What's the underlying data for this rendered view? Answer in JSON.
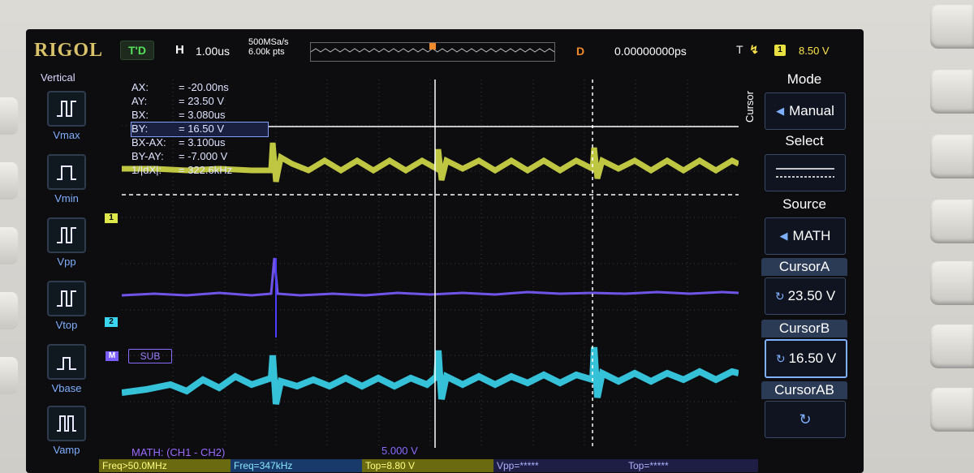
{
  "header": {
    "brand": "RIGOL",
    "trigger_status": "T'D",
    "horizontal_label": "H",
    "timebase": "1.00us",
    "sample_rate": "500MSa/s",
    "memory_depth": "6.00k pts",
    "delay_label": "D",
    "delay_value": "0.00000000ps",
    "trigger_label": "T",
    "trigger_channel": "1",
    "trigger_level": "8.50 V"
  },
  "vertical_menu": {
    "title": "Vertical",
    "items": [
      {
        "label": "Vmax",
        "icon": "vmax-icon"
      },
      {
        "label": "Vmin",
        "icon": "vmin-icon"
      },
      {
        "label": "Vpp",
        "icon": "vpp-icon"
      },
      {
        "label": "Vtop",
        "icon": "vtop-icon"
      },
      {
        "label": "Vbase",
        "icon": "vbase-icon"
      },
      {
        "label": "Vamp",
        "icon": "vamp-icon"
      }
    ]
  },
  "cursor_readout": [
    {
      "key": "AX:",
      "value": "= -20.00ns"
    },
    {
      "key": "AY:",
      "value": "= 23.50 V"
    },
    {
      "key": "BX:",
      "value": "= 3.080us"
    },
    {
      "key": "BY:",
      "value": "= 16.50 V"
    },
    {
      "key": "BX-AX:",
      "value": "= 3.100us"
    },
    {
      "key": "BY-AY:",
      "value": "= -7.000 V"
    },
    {
      "key": "1/|dX|:",
      "value": "= 322.6kHz"
    }
  ],
  "cursor_menu": {
    "side_label": "Cursor",
    "mode_title": "Mode",
    "mode_value": "Manual",
    "select_title": "Select",
    "source_title": "Source",
    "source_value": "MATH",
    "cursor_a_title": "CursorA",
    "cursor_a_value": "23.50 V",
    "cursor_b_title": "CursorB",
    "cursor_b_value": "16.50 V",
    "cursor_ab_title": "CursorAB"
  },
  "waveform": {
    "math_tag": "SUB",
    "math_label": "MATH: (CH1 - CH2)",
    "math_scale": "5.000 V",
    "ch1_marker": "1",
    "ch2_marker": "2",
    "math_marker": "M",
    "colors": {
      "ch1": "#dfe84a",
      "ch2": "#3ad6f0",
      "math": "#7a5cff",
      "cursor": "#ffffff"
    }
  },
  "measurements": {
    "freq1": "Freq>50.0MHz",
    "freq2": "Freq=347kHz",
    "top1": "Top=8.80 V",
    "vpp": "Vpp=*****",
    "top2": "Top=*****"
  }
}
